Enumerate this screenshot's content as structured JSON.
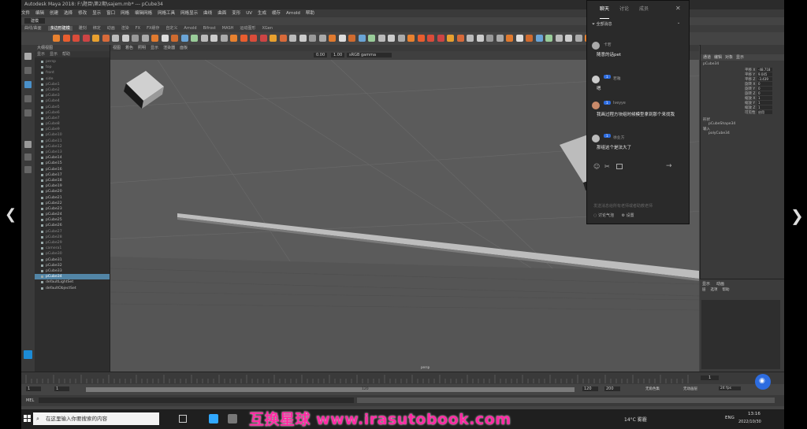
{
  "window": {
    "title": "Autodesk Maya 2018: F:\\题目\\第2期\\sajem.mb* --- pCube34",
    "menu": [
      "文件",
      "编辑",
      "创建",
      "选择",
      "修改",
      "显示",
      "窗口",
      "网格",
      "编辑网格",
      "网格工具",
      "网格显示",
      "曲线",
      "曲面",
      "变形",
      "UV",
      "生成",
      "缓存",
      "Arnold",
      "帮助"
    ],
    "mode": "建模"
  },
  "shelf_tabs": [
    "曲线/曲面",
    "多边形建模",
    "雕刻",
    "绑定",
    "动画",
    "渲染",
    "FX",
    "FX缓存",
    "自定义",
    "Arnold",
    "Bifrost",
    "MASH",
    "运动图形",
    "XGen"
  ],
  "shelf_active_index": 1,
  "viewport": {
    "menu": [
      "视图",
      "着色",
      "照明",
      "显示",
      "渲染器",
      "面板"
    ],
    "camera_label": "persp",
    "values": [
      "0.00",
      "1.00"
    ],
    "colorspace": "sRGB gamma"
  },
  "outliner": {
    "title": "大纲视图",
    "menu": [
      "显示",
      "显示",
      "帮助"
    ],
    "items": [
      {
        "label": "persp",
        "dim": true
      },
      {
        "label": "top",
        "dim": true
      },
      {
        "label": "front",
        "dim": true
      },
      {
        "label": "side",
        "dim": true
      },
      {
        "label": "pCube1",
        "dim": true
      },
      {
        "label": "pCube2",
        "dim": true
      },
      {
        "label": "pCube3",
        "dim": true
      },
      {
        "label": "pCube4",
        "dim": true
      },
      {
        "label": "pCube5",
        "dim": true
      },
      {
        "label": "pCube6",
        "dim": true
      },
      {
        "label": "pCube7",
        "dim": true
      },
      {
        "label": "pCube8",
        "dim": true
      },
      {
        "label": "pCube9",
        "dim": true
      },
      {
        "label": "pCube10",
        "dim": true
      },
      {
        "label": "pCube11",
        "dim": true
      },
      {
        "label": "pCube12",
        "dim": true
      },
      {
        "label": "pCube13",
        "dim": true
      },
      {
        "label": "pCube14",
        "dim": false
      },
      {
        "label": "pCube15",
        "dim": false
      },
      {
        "label": "pCube16",
        "dim": false
      },
      {
        "label": "pCube17",
        "dim": false
      },
      {
        "label": "pCube18",
        "dim": false
      },
      {
        "label": "pCube19",
        "dim": false
      },
      {
        "label": "pCube20",
        "dim": false
      },
      {
        "label": "pCube21",
        "dim": false
      },
      {
        "label": "pCube22",
        "dim": false
      },
      {
        "label": "pCube23",
        "dim": false
      },
      {
        "label": "pCube24",
        "dim": false
      },
      {
        "label": "pCube25",
        "dim": false
      },
      {
        "label": "pCube26",
        "dim": false
      },
      {
        "label": "pCube27",
        "dim": true
      },
      {
        "label": "pCube28",
        "dim": true
      },
      {
        "label": "pCube29",
        "dim": true
      },
      {
        "label": "camera1",
        "dim": true
      },
      {
        "label": "pCube30",
        "dim": true
      },
      {
        "label": "pCube31",
        "dim": false
      },
      {
        "label": "pCube32",
        "dim": false
      },
      {
        "label": "pCube33",
        "dim": false
      },
      {
        "label": "pCube34",
        "dim": false,
        "selected": true
      },
      {
        "label": "defaultLightSet",
        "dim": false
      },
      {
        "label": "defaultObjectSet",
        "dim": false
      }
    ]
  },
  "channel_box": {
    "tabs": [
      "通道",
      "编辑",
      "对象",
      "显示"
    ],
    "object": "pCube34",
    "attrs": [
      {
        "name": "平移 X",
        "value": "-48.718"
      },
      {
        "name": "平移 Y",
        "value": "9.045"
      },
      {
        "name": "平移 Z",
        "value": "-3.439"
      },
      {
        "name": "旋转 X",
        "value": "0"
      },
      {
        "name": "旋转 Y",
        "value": "0"
      },
      {
        "name": "旋转 Z",
        "value": "0"
      },
      {
        "name": "缩放 X",
        "value": "1"
      },
      {
        "name": "缩放 Y",
        "value": "1"
      },
      {
        "name": "缩放 Z",
        "value": "1"
      },
      {
        "name": "可见性",
        "value": "启用"
      }
    ],
    "shapes_label": "形状",
    "shape_name": "pCubeShape34",
    "inputs_label": "输入",
    "input_name": "polyCube34",
    "layer_tabs": [
      "显示",
      "动画"
    ],
    "layer_menu": [
      "层",
      "选项",
      "帮助"
    ]
  },
  "timeline": {
    "start": "1",
    "end": "120",
    "range_start": "1",
    "range_end": "120",
    "range_out": "200",
    "current": "1",
    "char_set": "无角色集",
    "anim_layer": "无动画层",
    "fps": "24 fps"
  },
  "cmdline": {
    "label": "MEL"
  },
  "taskbar": {
    "search_placeholder": "在这里输入你要搜索的内容",
    "weather": "14°C 雾霾",
    "lang": "ENG",
    "time": "13:16",
    "date": "2022/10/30"
  },
  "chat": {
    "tabs": [
      "聊天",
      "讨论",
      "成员"
    ],
    "active_tab": 0,
    "filter": "全部消息",
    "messages": [
      {
        "name": "卡若",
        "badge": "",
        "text": "随意的话pet"
      },
      {
        "name": "若雅",
        "badge": "1",
        "text": "嗯"
      },
      {
        "name": "Iveyye",
        "badge": "1",
        "text": "我画过程方块组时候模型拿到那个来找我"
      },
      {
        "name": "徐业方",
        "badge": "1",
        "text": "那组这个是法大了"
      }
    ],
    "input_placeholder": "发送消息给所有老师或者助教老师",
    "footer": [
      "讨论气泡",
      "设置"
    ]
  },
  "watermark": "互换星球 www.irasutobook.com"
}
